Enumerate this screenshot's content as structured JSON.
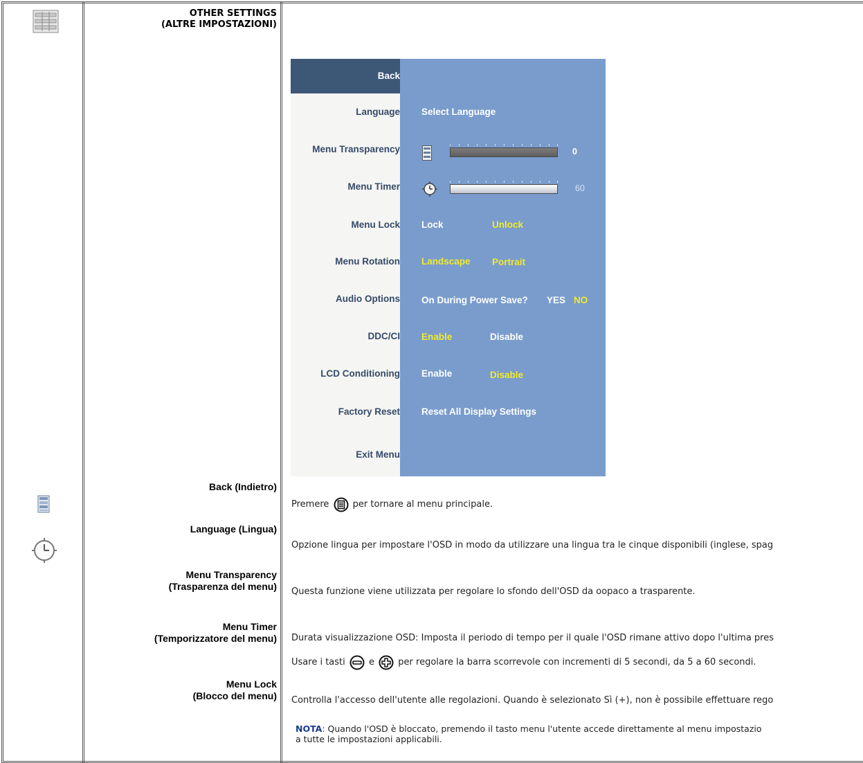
{
  "section": {
    "title_line1": "OTHER SETTINGS",
    "title_line2": "(ALTRE IMPOSTAZIONI)"
  },
  "osd": {
    "menu": [
      "Back",
      "Language",
      "Menu Transparency",
      "Menu Timer",
      "Menu Lock",
      "Menu Rotation",
      "Audio Options",
      "DDC/CI",
      "LCD Conditioning",
      "Factory Reset",
      "Exit Menu"
    ],
    "select_language": "Select Language",
    "transparency_value": "0",
    "timer_value": "60",
    "lock": "Lock",
    "unlock": "Unlock",
    "landscape": "Landscape",
    "portrait": "Portrait",
    "power_save_question": "On During Power Save?",
    "yes": "YES",
    "no": "NO",
    "ddc_enable": "Enable",
    "ddc_disable": "Disable",
    "lcd_enable": "Enable",
    "lcd_disable": "Disable",
    "reset_all": "Reset All Display Settings",
    "colors": {
      "panel": "#799ccc",
      "highlight": "#f3ea2a",
      "back_selected": "#3d5777",
      "menu_text": "#344a68"
    }
  },
  "rows": {
    "back_label": "Back (Indietro)",
    "back_desc_before": "Premere",
    "back_desc_after": "per tornare al menu principale.",
    "language_label": "Language (Lingua)",
    "language_desc": "Opzione lingua per impostare l'OSD in modo da utilizzare una lingua tra le cinque disponibili (inglese, spag",
    "transparency_label1": "Menu  Transparency",
    "transparency_label2": "(Trasparenza del menu)",
    "transparency_desc": "Questa funzione viene utilizzata per regolare lo sfondo dell'OSD da oopaco a trasparente.",
    "timer_label1": "Menu Timer",
    "timer_label2": "(Temporizzatore del menu)",
    "timer_desc1": "Durata visualizzazione OSD: Imposta il periodo di tempo per il quale l'OSD rimane attivo dopo l'ultima pres",
    "timer_desc2_a": "Usare i tasti",
    "timer_desc2_b": "e",
    "timer_desc2_c": "per regolare la barra scorrevole con incrementi di 5 secondi, da 5 a 60 secondi.",
    "lock_label1": "Menu Lock",
    "lock_label2": "(Blocco del menu)",
    "lock_desc": "Controlla l'accesso dell'utente alle regolazioni. Quando è selezionato Sì (+), non è possibile effettuare rego",
    "nota_label": "NOTA",
    "nota_text1": ": Quando l'OSD è bloccato, premendo il tasto menu l'utente accede direttamente al menu impostazio",
    "nota_text2": "a tutte le impostazioni applicabili."
  }
}
